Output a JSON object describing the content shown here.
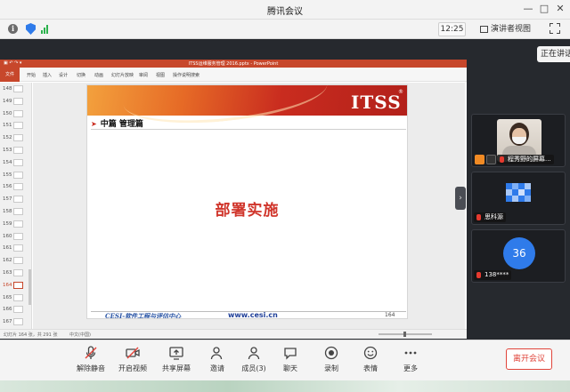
{
  "window": {
    "title": "腾讯会议"
  },
  "toolbar": {
    "time": "12:25",
    "view_label": "演讲者视图"
  },
  "speaking": {
    "text": "正在讲话"
  },
  "ppt": {
    "title": "ITSS运维服务管理 2016.pptx - PowerPoint",
    "file_label": "文件",
    "menu": [
      "开始",
      "插入",
      "设计",
      "切换",
      "动画",
      "幻灯片放映",
      "审阅",
      "视图",
      "操作说明搜索"
    ],
    "thumb_numbers": [
      "148",
      "149",
      "150",
      "151",
      "152",
      "153",
      "154",
      "155",
      "156",
      "157",
      "158",
      "159",
      "160",
      "161",
      "162",
      "163",
      "164",
      "165",
      "166",
      "167"
    ],
    "active_thumb": "164",
    "status_left": "幻灯片 164 张，共 291 张",
    "status_lang": "中文(中国)"
  },
  "slide": {
    "logo": "ITSS",
    "registered": "®",
    "subtitle": "中篇 管理篇",
    "heading": "部署实施",
    "footer_org": "CESI-软件工程与评估中心",
    "footer_url": "www.cesi.cn",
    "page": "164"
  },
  "participants": [
    {
      "name": "程秀野的屏幕..."
    },
    {
      "name": "思科源"
    },
    {
      "name": "138****",
      "avatar_text": "36"
    }
  ],
  "bottom": {
    "mute": "解除静音",
    "video": "开启视频",
    "share": "共享屏幕",
    "invite": "邀请",
    "members": "成员(3)",
    "chat": "聊天",
    "record": "录制",
    "emoji": "表情",
    "more": "更多",
    "end": "离开会议"
  },
  "colors": {
    "accent_red": "#e0443a",
    "ppt_red": "#c7472b",
    "blue": "#2f7bea"
  }
}
